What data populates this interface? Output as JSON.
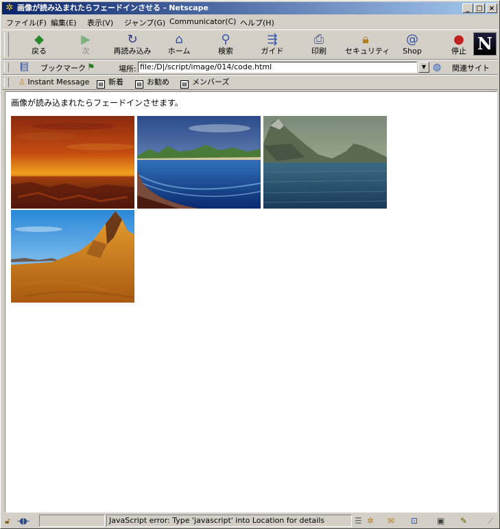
{
  "window": {
    "title": "画像が読み込まれたらフェードインさせる - Netscape",
    "controls": {
      "minimize": "_",
      "maximize": "□",
      "close": "×"
    }
  },
  "menu": [
    "ファイル(F)",
    "編集(E)",
    "表示(V)",
    "ジャンプ(G)",
    "Communicator(C)",
    "ヘルプ(H)"
  ],
  "nav": [
    {
      "label": "戻る",
      "icon": "back-arrow",
      "enabled": true
    },
    {
      "label": "次",
      "icon": "forward-arrow",
      "enabled": false
    },
    {
      "label": "再読み込み",
      "icon": "reload",
      "enabled": true
    },
    {
      "label": "ホーム",
      "icon": "home",
      "enabled": true
    },
    {
      "label": "検索",
      "icon": "search",
      "enabled": true
    },
    {
      "label": "ガイド",
      "icon": "guide",
      "enabled": true
    },
    {
      "label": "印刷",
      "icon": "print",
      "enabled": true
    },
    {
      "label": "セキュリティ",
      "icon": "security",
      "enabled": true
    },
    {
      "label": "Shop",
      "icon": "shop",
      "enabled": true
    },
    {
      "label": "停止",
      "icon": "stop",
      "enabled": true
    }
  ],
  "location": {
    "bookmarks_label": "ブックマーク",
    "field_label": "場所:",
    "url": "file:/D|/script/image/014/code.html",
    "related_label": "関連サイト"
  },
  "personal_toolbar": [
    "Instant Message",
    "新着",
    "お勧め",
    "メンバーズ"
  ],
  "page": {
    "heading": "画像が読み込まれたらフェードインさせます。",
    "images": [
      "sunset-sea-landscape",
      "coastal-bay-landscape",
      "mountain-lake-landscape",
      "desert-peak-landscape"
    ]
  },
  "status": {
    "message": "JavaScript error: Type 'javascript' into Location for details"
  },
  "colors": {
    "titlebar": "#0a246a",
    "chrome": "#d4d0c8"
  }
}
